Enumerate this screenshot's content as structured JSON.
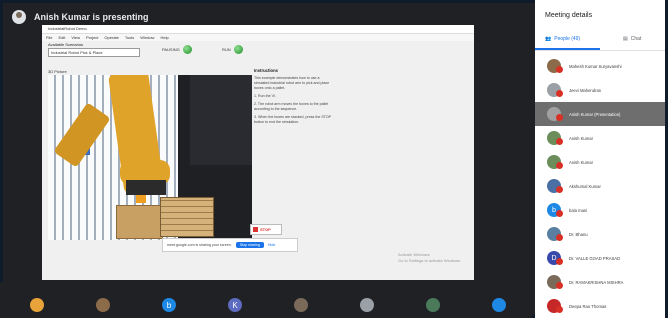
{
  "presenter": {
    "text": "Anish Kumar is presenting"
  },
  "shared_app": {
    "window_title": "IndustrialRobot Demo",
    "menu": [
      "File",
      "Edit",
      "View",
      "Project",
      "Operate",
      "Tools",
      "Window",
      "Help"
    ],
    "combo_label": "Available Scenarios",
    "combo_value": "Industrial Robot Pick & Place",
    "indicator1": "PAUSING",
    "indicator2": "RUN",
    "stage_label": "3D Picture",
    "instructions": {
      "title": "Instructions",
      "paragraphs": [
        "This example demonstrates how to use a simulated industrial robot arm to pick and place boxes onto a pallet.",
        "1. Run the VI.",
        "2. The robot arm moves the boxes to the pallet according to the sequence.",
        "3. When the boxes are stacked, press the STOP button to end the simulation."
      ]
    },
    "stop_label": "STOP",
    "watermark_line1": "Activate Windows",
    "watermark_line2": "Go to Settings to activate Windows."
  },
  "share_bar": {
    "text": "meet.google.com is sharing your screen.",
    "stop_label": "Stop sharing",
    "hide_label": "Hide"
  },
  "panel": {
    "title": "Meeting details",
    "tabs": {
      "people": "People (49)",
      "chat": "Chat"
    },
    "participants": [
      {
        "name": "Mahesh Kumar Suryavanshi",
        "avatar_color": "#8b6b4a",
        "initial": "",
        "highlight": false
      },
      {
        "name": "Jeevi Mahendran",
        "avatar_color": "#9aa0a6",
        "initial": "",
        "highlight": false
      },
      {
        "name": "Anish Kumar (Presentation)",
        "avatar_color": "#a0a0a0",
        "initial": "",
        "highlight": true
      },
      {
        "name": "Anish Kumar",
        "avatar_color": "#6b8e5a",
        "initial": "",
        "highlight": false
      },
      {
        "name": "Anish Kumar",
        "avatar_color": "#6b8e5a",
        "initial": "",
        "highlight": false
      },
      {
        "name": "Akshumal Kumar",
        "avatar_color": "#4a6fa5",
        "initial": "",
        "highlight": false
      },
      {
        "name": "bala mani",
        "avatar_color": "#1e88e5",
        "initial": "b",
        "highlight": false
      },
      {
        "name": "Dr. Bhanu",
        "avatar_color": "#5a7fa0",
        "initial": "",
        "highlight": false
      },
      {
        "name": "Dr. VALLE GOAD PRASAD",
        "avatar_color": "#3949ab",
        "initial": "D",
        "highlight": false
      },
      {
        "name": "Dr. RAMAKRISHNA MISHRA",
        "avatar_color": "#7a6a5a",
        "initial": "",
        "highlight": false
      },
      {
        "name": "Deepa Rao Thomas",
        "avatar_color": "#c62828",
        "initial": "",
        "highlight": false
      }
    ]
  },
  "bottom_tiles": [
    {
      "color": "#e8a33a",
      "initial": ""
    },
    {
      "color": "#8b6b4a",
      "initial": ""
    },
    {
      "color": "#1e88e5",
      "initial": "b"
    },
    {
      "color": "#5c6bc0",
      "initial": "K"
    },
    {
      "color": "#7a6a5a",
      "initial": ""
    },
    {
      "color": "#9aa0a6",
      "initial": ""
    },
    {
      "color": "#4a7a5a",
      "initial": ""
    },
    {
      "color": "#1e88e5",
      "initial": ""
    }
  ]
}
